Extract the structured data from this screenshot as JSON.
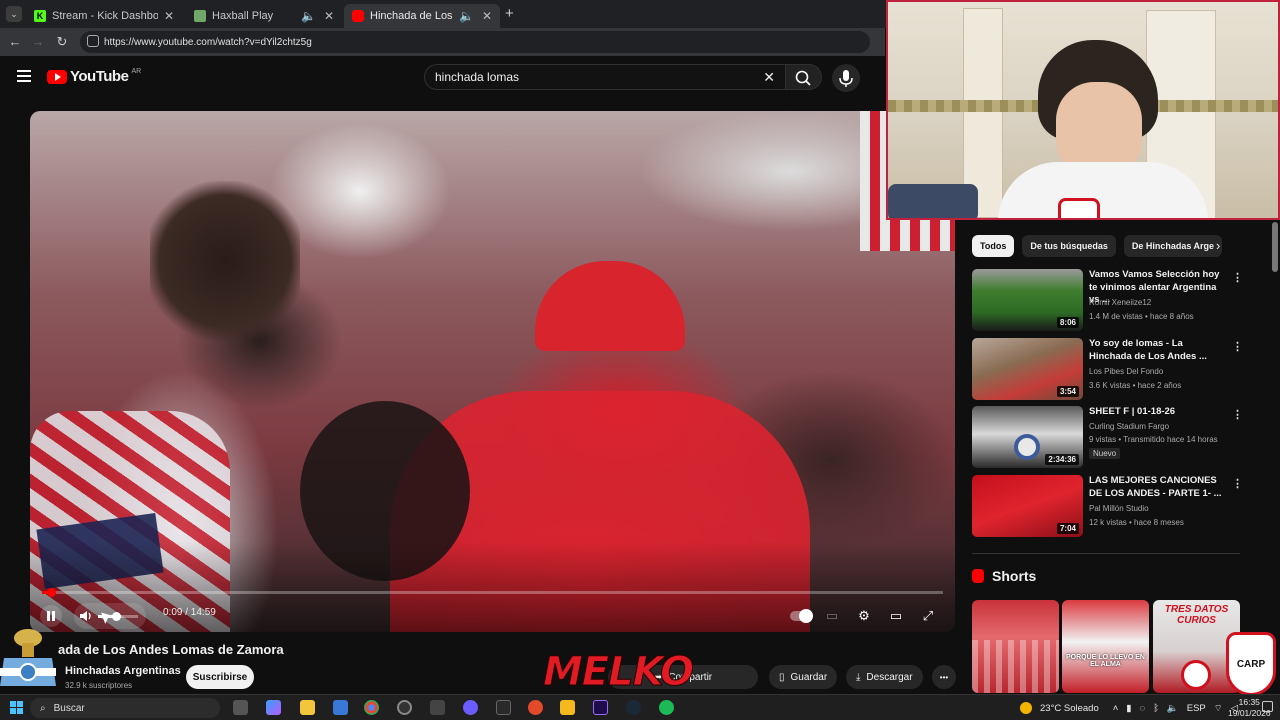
{
  "browser": {
    "tabs": [
      {
        "title": "Stream - Kick Dashboard",
        "favicon_color": "#53fc18"
      },
      {
        "title": "Haxball Play",
        "favicon_color": "#6fa86a"
      },
      {
        "title": "Hinchada de Los Andes Lo",
        "favicon_color": "#ff0000"
      }
    ],
    "new_tab": "+",
    "url": "https://www.youtube.com/watch?v=dYil2chtz5g"
  },
  "youtube": {
    "logo": "YouTube",
    "region": "AR",
    "search_value": "hinchada lomas",
    "clear_icon": "✕"
  },
  "player": {
    "time": "0:09 / 14:59",
    "progress_fraction": 0.01,
    "volume_fraction": 0.45
  },
  "video": {
    "title": "ada de Los Andes Lomas de Zamora",
    "channel": "Hinchadas Argentinas",
    "subscribers": "32.9 k suscriptores",
    "subscribe_label": "Suscribirse",
    "actions": [
      {
        "label": "Compartir",
        "icon": "share-icon"
      },
      {
        "label": "Guardar",
        "icon": "bookmark-icon"
      },
      {
        "label": "Descargar",
        "icon": "download-icon"
      }
    ],
    "more": "•••",
    "overlay_text": "MELKO"
  },
  "sidebar": {
    "chips": [
      "Todos",
      "De tus búsquedas",
      "De Hinchadas Arge"
    ],
    "recommendations": [
      {
        "title": "Vamos Vamos Selección hoy te vinimos alentar Argentina vs ...",
        "channel": "Romii Xeneiize12",
        "meta": "1.4 M de vistas • hace 8 años",
        "duration": "8:06",
        "badge": ""
      },
      {
        "title": "Yo soy de lomas - La Hinchada de Los Andes ...",
        "channel": "Los Pibes Del Fondo",
        "meta": "3.6 K vistas • hace 2 años",
        "duration": "3:54",
        "badge": ""
      },
      {
        "title": "SHEET F | 01-18-26",
        "channel": "Curling Stadium Fargo",
        "meta": "9 vistas • Transmitido hace 14 horas",
        "duration": "2:34:36",
        "badge": "Nuevo"
      },
      {
        "title": "LAS MEJORES CANCIONES DE LOS ANDES - PARTE 1- ...",
        "channel": "Pal Millón Studio",
        "meta": "12 k vistas • hace 8 meses",
        "duration": "7:04",
        "badge": ""
      }
    ],
    "shorts_label": "Shorts",
    "shorts_texts": [
      "",
      "PORQUE LO LLEVO EN EL ALMA",
      "TRES DATOS CURIOS"
    ]
  },
  "webcam": {
    "badge_text": "CARP"
  },
  "taskbar": {
    "search_placeholder": "Buscar",
    "weather": "23°C  Soleado",
    "language": "ESP",
    "time": "16:35",
    "date": "19/01/2026"
  },
  "colors": {
    "accent": "#ff0000",
    "background": "#0f0f0f",
    "webcam_border": "#c0223d"
  }
}
